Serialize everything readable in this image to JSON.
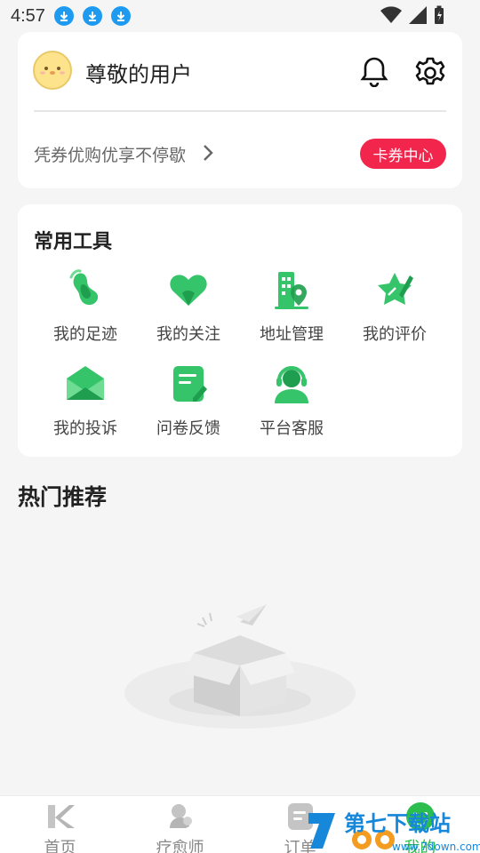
{
  "status_bar": {
    "time": "4:57",
    "download_icons": [
      "download-icon",
      "download-icon",
      "download-icon"
    ]
  },
  "user_card": {
    "username": "尊敬的用户",
    "promo_text": "凭券优购优享不停歇",
    "coupon_button": "卡券中心"
  },
  "tools": {
    "title": "常用工具",
    "items": [
      {
        "label": "我的足迹",
        "icon": "footprint-icon"
      },
      {
        "label": "我的关注",
        "icon": "heart-icon"
      },
      {
        "label": "地址管理",
        "icon": "building-location-icon"
      },
      {
        "label": "我的评价",
        "icon": "star-pen-icon"
      },
      {
        "label": "我的投诉",
        "icon": "envelope-icon"
      },
      {
        "label": "问卷反馈",
        "icon": "questionnaire-icon"
      },
      {
        "label": "平台客服",
        "icon": "headset-icon"
      }
    ]
  },
  "hot": {
    "title": "热门推荐"
  },
  "tab_bar": {
    "items": [
      {
        "label": "首页"
      },
      {
        "label": "疗愈师"
      },
      {
        "label": "订单"
      },
      {
        "label": "我的"
      }
    ]
  },
  "watermark": {
    "text": "第七下载站",
    "url": "www.7down.com"
  },
  "colors": {
    "accent_green": "#2bbd4d",
    "coupon_red": "#f2264d",
    "background": "#f5f5f5"
  }
}
